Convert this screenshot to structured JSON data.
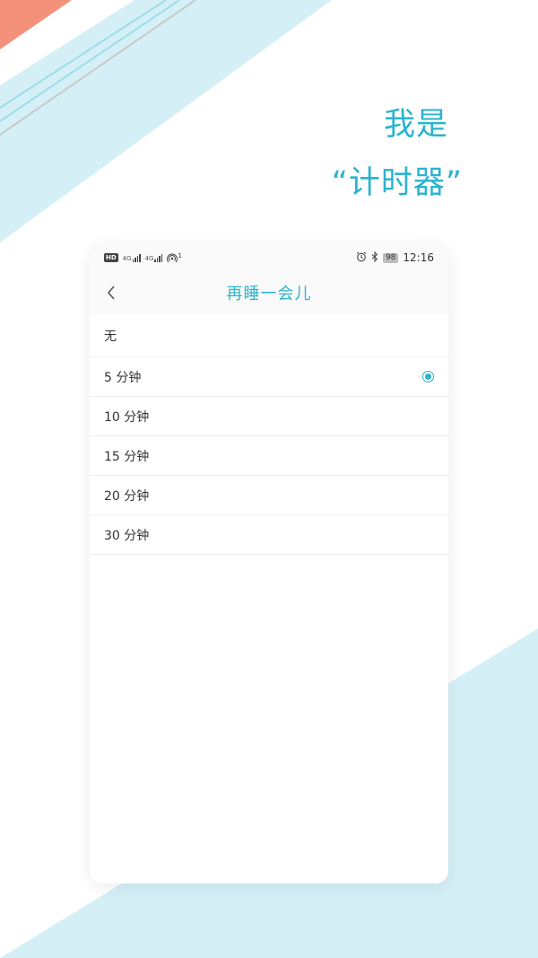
{
  "colors": {
    "accent": "#2bb3cc",
    "stripe_light": "#d4f0f6",
    "coral": "#f4917a"
  },
  "promo": {
    "line1": "我是",
    "line2": "“计时器”"
  },
  "status_bar": {
    "hd_badge": "HD",
    "sim1": "4G",
    "sim2": "4G",
    "hotspot_count": "1",
    "battery": "98",
    "time": "12:16",
    "icons": [
      "alarm-icon",
      "bluetooth-icon",
      "hotspot-icon",
      "signal-icon"
    ]
  },
  "app_bar": {
    "title": "再睡一会儿",
    "back_icon": "chevron-left-icon"
  },
  "options": [
    {
      "label": "无",
      "selected": false
    },
    {
      "label": "5 分钟",
      "selected": true
    },
    {
      "label": "10 分钟",
      "selected": false
    },
    {
      "label": "15 分钟",
      "selected": false
    },
    {
      "label": "20 分钟",
      "selected": false
    },
    {
      "label": "30 分钟",
      "selected": false
    }
  ]
}
